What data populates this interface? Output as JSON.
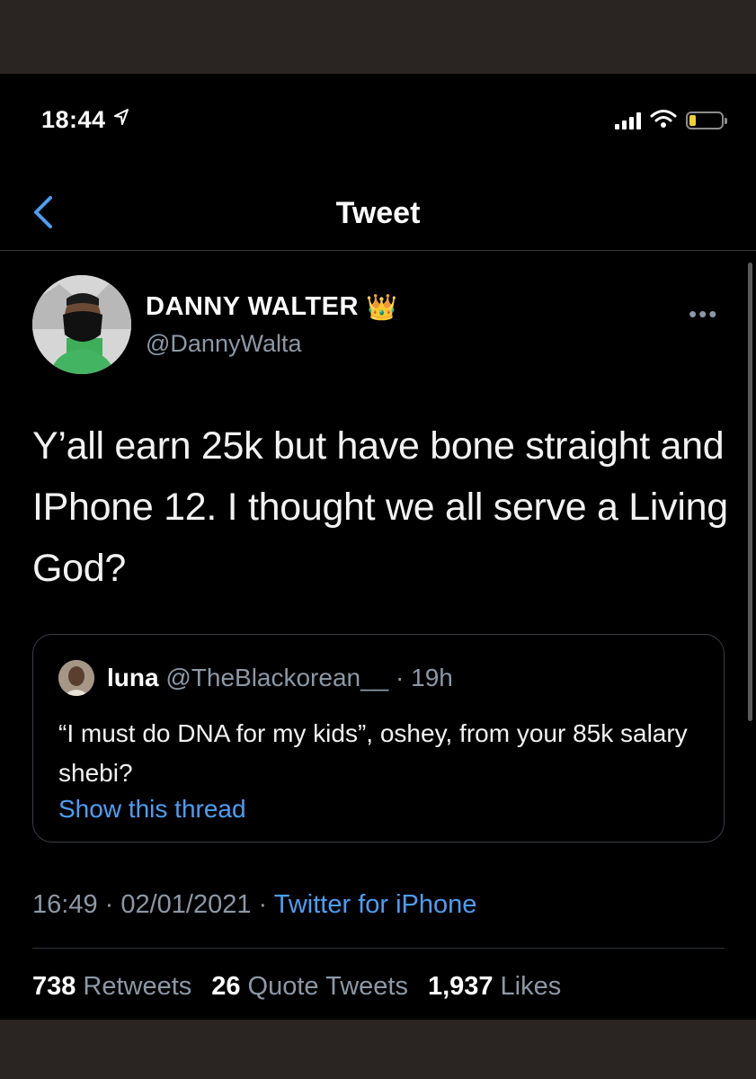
{
  "status_bar": {
    "time": "18:44",
    "location_icon": "location-arrow-icon",
    "signal_icon": "cellular-signal-icon",
    "wifi_icon": "wifi-icon",
    "battery_icon": "battery-icon",
    "battery_level": 0.2,
    "battery_color": "#f3d02c"
  },
  "nav": {
    "title": "Tweet",
    "back_icon": "chevron-left-icon"
  },
  "tweet": {
    "author_name": "DANNY WALTER",
    "author_badge": "👑",
    "author_handle": "@DannyWalta",
    "more_label": "•••",
    "text": "Y’all earn 25k but have bone straight and IPhone 12. I thought we all serve a Living God?",
    "quote": {
      "name": "luna",
      "handle": "@TheBlackorean__",
      "time": "· 19h",
      "text": "“I must do DNA for my kids”, oshey, from your 85k salary shebi?",
      "show_thread": "Show this thread"
    },
    "timestamp": "16:49 · 02/01/2021 ·",
    "source": "Twitter for iPhone",
    "stats": {
      "retweets_count": "738",
      "retweets_label": "Retweets",
      "quotes_count": "26",
      "quotes_label": "Quote Tweets",
      "likes_count": "1,937",
      "likes_label": "Likes"
    }
  },
  "colors": {
    "background": "#000000",
    "accent": "#4a9ff5",
    "secondary_text": "#8b98a5",
    "frame": "#2a2522"
  }
}
